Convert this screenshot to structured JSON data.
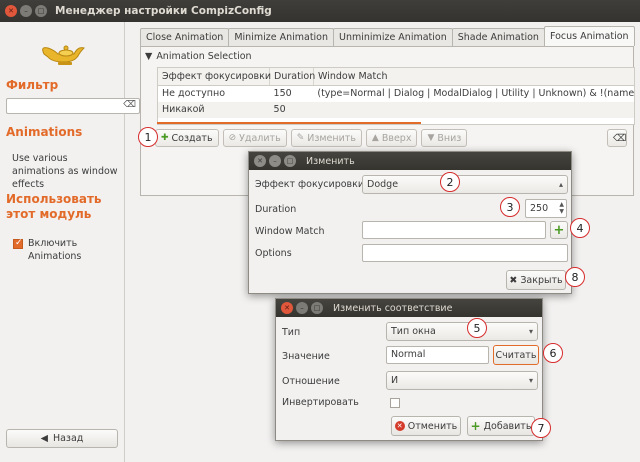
{
  "window": {
    "title": "Менеджер настройки CompizConfig"
  },
  "sidebar": {
    "filter_label": "Фильтр",
    "filter_value": "",
    "plugin_title": "Animations",
    "plugin_desc": "Use various animations as window effects",
    "use_title": "Использовать этот модуль",
    "enable_label": "Включить Animations",
    "enable_checked": true,
    "back_label": "Назад"
  },
  "tabs": [
    "Close Animation",
    "Minimize Animation",
    "Unminimize Animation",
    "Shade Animation",
    "Focus Animation"
  ],
  "active_tab": "Focus Animation",
  "panel": {
    "section_label": "Animation Selection",
    "columns": [
      "Эффект фокусировки",
      "Duration",
      "Window Match"
    ],
    "rows": [
      {
        "effect": "Не доступно",
        "duration": "150",
        "match": "(type=Normal | Dialog | ModalDialog | Utility | Unknown) & !(name="
      },
      {
        "effect": "Никакой",
        "duration": "50",
        "match": ""
      }
    ],
    "toolbar": {
      "add": "Создать",
      "delete": "Удалить",
      "edit": "Изменить",
      "up": "Вверх",
      "down": "Вниз"
    }
  },
  "edit_dialog": {
    "title": "Изменить",
    "effect_label": "Эффект фокусировки",
    "effect_value": "Dodge",
    "duration_label": "Duration",
    "duration_value": "250",
    "match_label": "Window Match",
    "match_value": "",
    "options_label": "Options",
    "options_value": "",
    "close_label": "Закрыть"
  },
  "match_dialog": {
    "title": "Изменить соответствие",
    "type_label": "Тип",
    "type_value": "Тип окна",
    "value_label": "Значение",
    "value_value": "Normal",
    "grab_label": "Считать",
    "relation_label": "Отношение",
    "relation_value": "И",
    "invert_label": "Инвертировать",
    "invert_checked": false,
    "cancel_label": "Отменить",
    "add_label": "Добавить"
  },
  "callouts": [
    "1",
    "2",
    "3",
    "4",
    "5",
    "6",
    "7",
    "8"
  ],
  "colors": {
    "accent": "#e36b2a",
    "callout": "#d62b2b",
    "titlebar": "#3a3935"
  }
}
